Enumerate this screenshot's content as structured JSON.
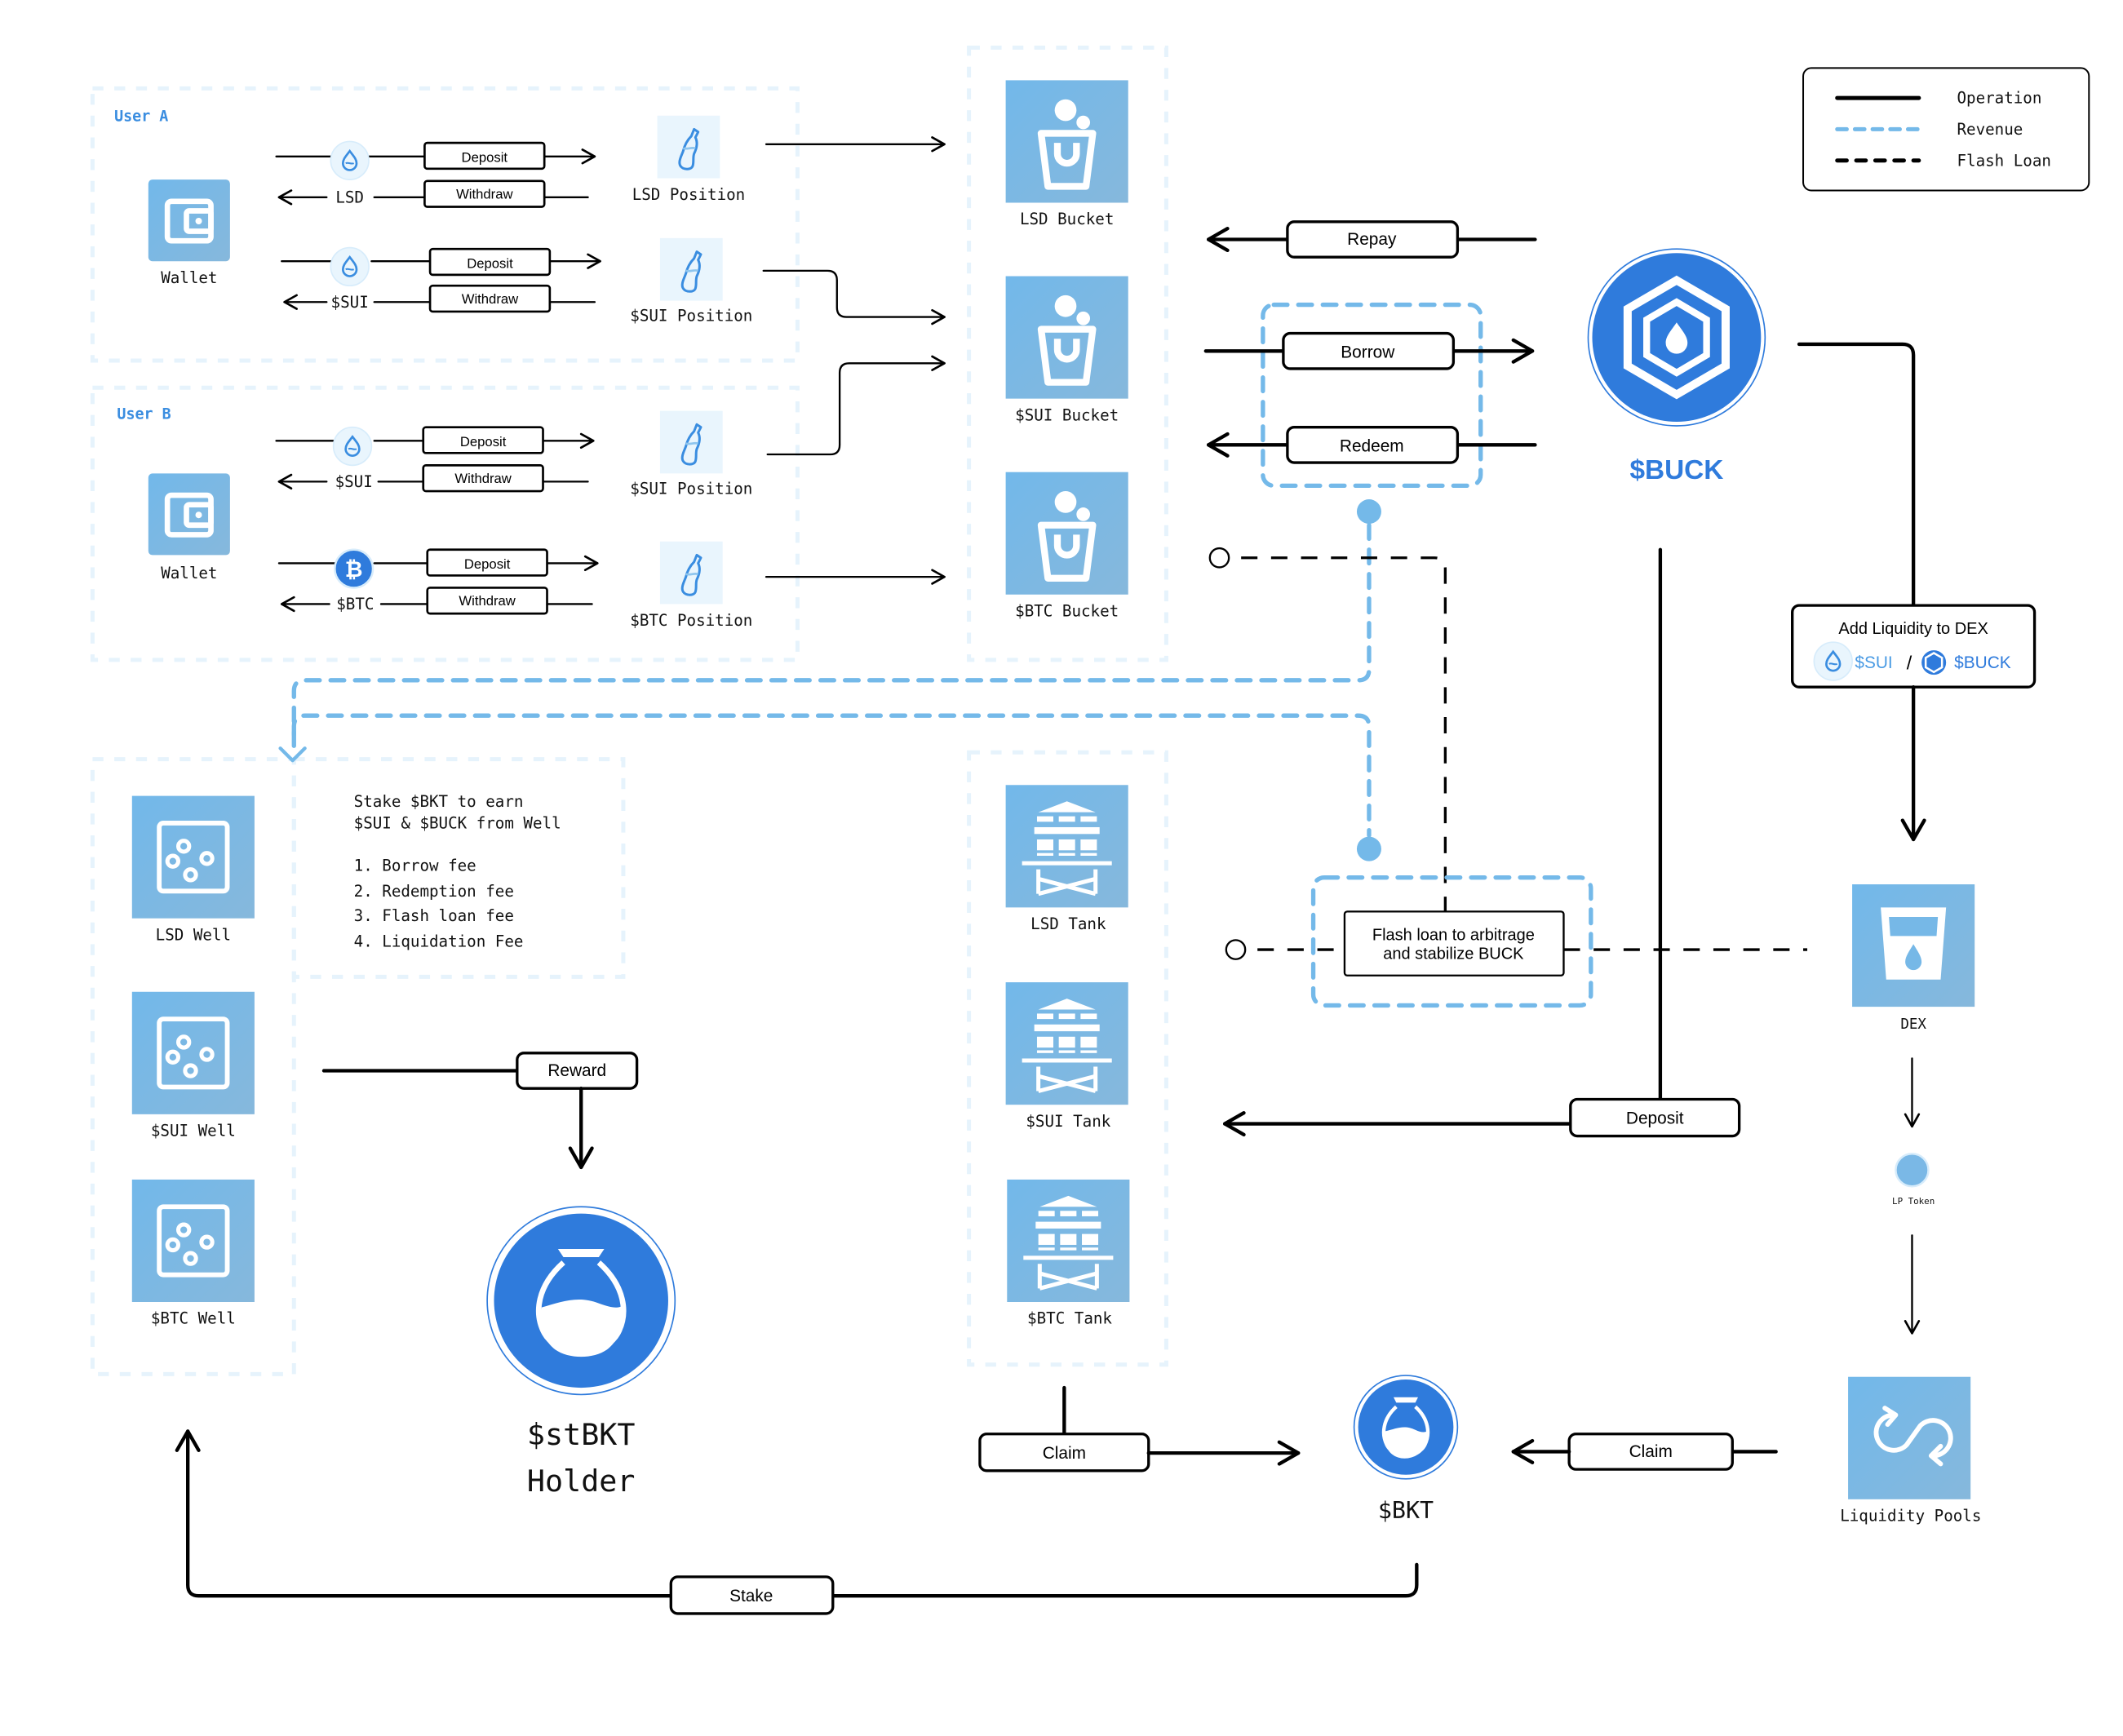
{
  "legend": {
    "items": [
      {
        "label": "Operation",
        "style": "solid",
        "color": "#000000"
      },
      {
        "label": "Revenue",
        "style": "dashed",
        "color": "#74b9e9"
      },
      {
        "label": "Flash Loan",
        "style": "dashed",
        "color": "#000000"
      }
    ]
  },
  "colors": {
    "accent": "#2f7bdc",
    "tile": "#76b8e7",
    "revenue": "#74b9e9",
    "group_border": "#e6f3fc"
  },
  "users": [
    {
      "title": "User A",
      "wallet_label": "Wallet",
      "rows": [
        {
          "token": "LSD",
          "token_icon": "sui-drop-icon",
          "deposit": "Deposit",
          "withdraw": "Withdraw",
          "position": "LSD Position"
        },
        {
          "token": "$SUI",
          "token_icon": "sui-drop-icon",
          "deposit": "Deposit",
          "withdraw": "Withdraw",
          "position": "$SUI Position"
        }
      ]
    },
    {
      "title": "User B",
      "wallet_label": "Wallet",
      "rows": [
        {
          "token": "$SUI",
          "token_icon": "sui-drop-icon",
          "deposit": "Deposit",
          "withdraw": "Withdraw",
          "position": "$SUI Position"
        },
        {
          "token": "$BTC",
          "token_icon": "bitcoin-icon",
          "deposit": "Deposit",
          "withdraw": "Withdraw",
          "position": "$BTC Position"
        }
      ]
    }
  ],
  "buckets": [
    "LSD Bucket",
    "$SUI Bucket",
    "$BTC Bucket"
  ],
  "tanks": [
    "LSD Tank",
    "$SUI Tank",
    "$BTC Tank"
  ],
  "wells": [
    "LSD Well",
    "$SUI Well",
    "$BTC Well"
  ],
  "operations": {
    "repay": "Repay",
    "borrow": "Borrow",
    "redeem": "Redeem",
    "deposit": "Deposit",
    "reward": "Reward",
    "claim_tank": "Claim",
    "claim_lp": "Claim",
    "stake": "Stake"
  },
  "buck": {
    "label": "$BUCK"
  },
  "add_liquidity": {
    "title": "Add Liquidity to DEX",
    "pair_left": "$SUI",
    "separator": "/",
    "pair_right": "$BUCK"
  },
  "dex": {
    "label": "DEX"
  },
  "lp_token": {
    "label": "LP Token"
  },
  "liquidity_pools": {
    "label": "Liquidity Pools"
  },
  "flash_loan": {
    "line1": "Flash loan to arbitrage",
    "line2": "and stabilize BUCK"
  },
  "stake_note": {
    "line1": "Stake $BKT to earn",
    "line2": "$SUI & $BUCK from Well",
    "fees": [
      "1. Borrow fee",
      "2. Redemption fee",
      "3. Flash loan fee",
      "4. Liquidation Fee"
    ]
  },
  "stbkt": {
    "line1": "$stBKT",
    "line2": "Holder"
  },
  "bkt": {
    "label": "$BKT"
  }
}
